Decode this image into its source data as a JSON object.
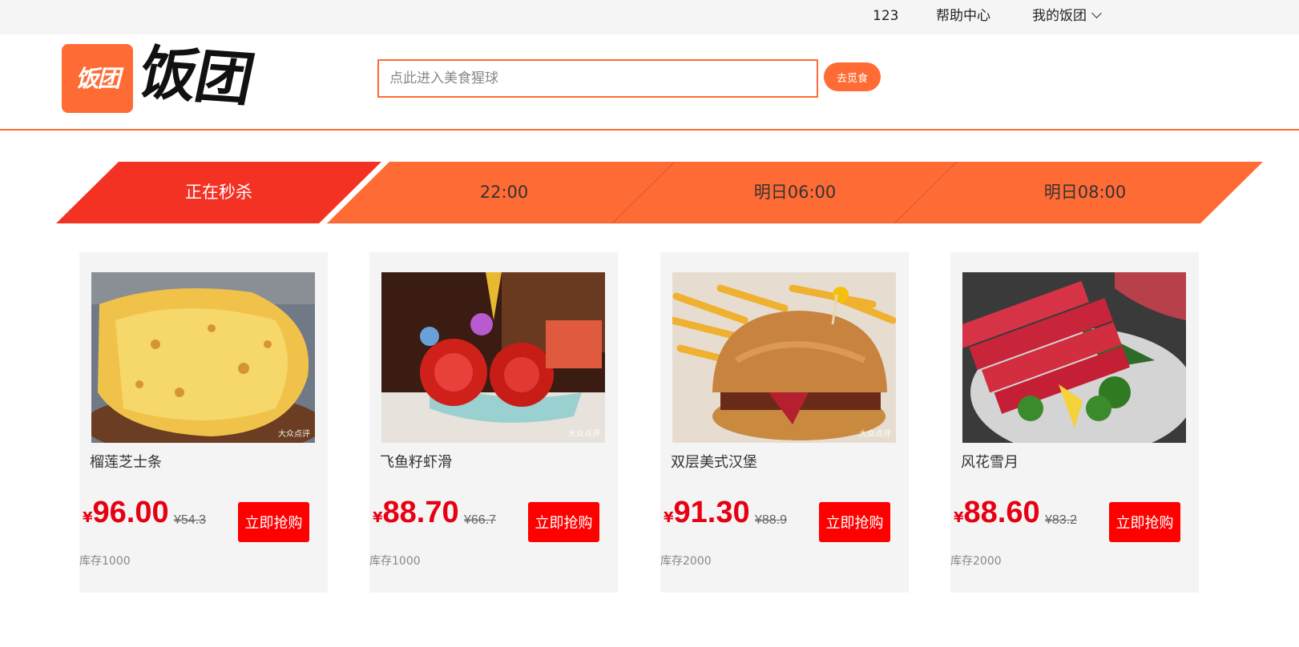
{
  "topbar": {
    "user": "123",
    "help": "帮助中心",
    "mine": "我的饭团"
  },
  "header": {
    "logo_badge": "饭团",
    "logo_text": "饭团",
    "search_placeholder": "点此进入美食猩球",
    "search_button": "去觅食"
  },
  "tabs": [
    {
      "label": "正在秒杀",
      "active": true
    },
    {
      "label": "22:00",
      "active": false
    },
    {
      "label": "明日06:00",
      "active": false
    },
    {
      "label": "明日08:00",
      "active": false
    }
  ],
  "colors": {
    "accent": "#ff6b35",
    "active_tab": "#f43224",
    "price": "#e60012",
    "buy_button": "#ff0000"
  },
  "products": [
    {
      "name": "榴莲芝士条",
      "currency": "¥",
      "price": "96.00",
      "original": "¥54.3",
      "buy": "立即抢购",
      "stock": "库存1000",
      "watermark": "大众点评",
      "icon": "pizza-image"
    },
    {
      "name": "飞鱼籽虾滑",
      "currency": "¥",
      "price": "88.70",
      "original": "¥66.7",
      "buy": "立即抢购",
      "stock": "库存1000",
      "watermark": "大众点评",
      "icon": "rose-dish-image"
    },
    {
      "name": "双层美式汉堡",
      "currency": "¥",
      "price": "91.30",
      "original": "¥88.9",
      "buy": "立即抢购",
      "stock": "库存2000",
      "watermark": "大众点评",
      "icon": "burger-image"
    },
    {
      "name": "风花雪月",
      "currency": "¥",
      "price": "88.60",
      "original": "¥83.2",
      "buy": "立即抢购",
      "stock": "库存2000",
      "watermark": "",
      "icon": "beef-image"
    }
  ]
}
